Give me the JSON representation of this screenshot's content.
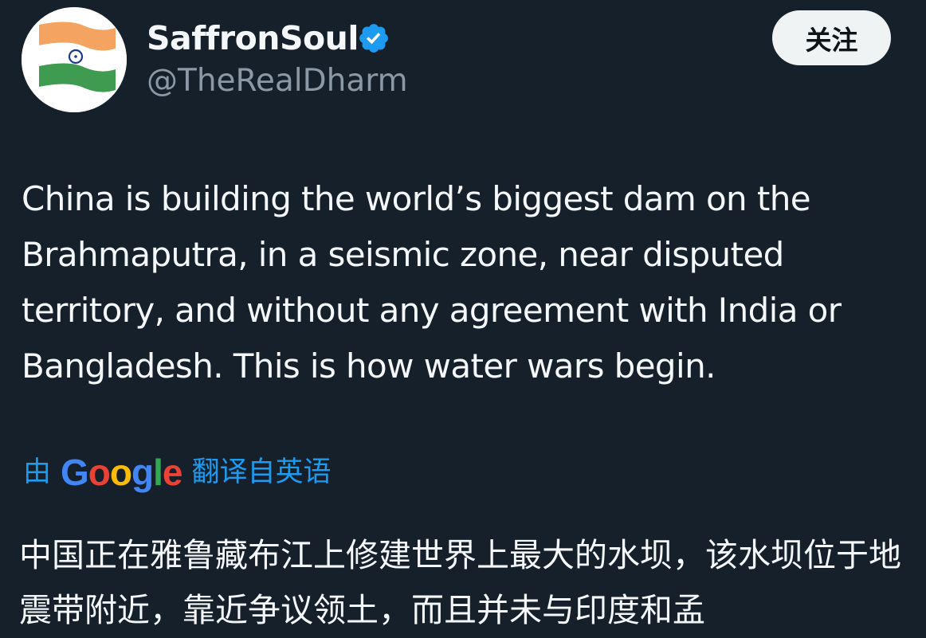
{
  "author": {
    "display_name": "SaffronSoul",
    "handle": "@TheRealDharm",
    "avatar_icon": "india-flag-icon",
    "verified": true,
    "verified_color": "#1d9bf0"
  },
  "follow_button": {
    "label": "关注"
  },
  "tweet": {
    "text": "China is building the world’s biggest dam on the Brahmaputra, in a seismic zone, near disputed territory, and without any agreement with India or Bangladesh. This is how water wars begin."
  },
  "translation": {
    "prefix": "由",
    "provider_letters": [
      "G",
      "o",
      "o",
      "g",
      "l",
      "e"
    ],
    "suffix": "翻译自英语",
    "text": "中国正在雅鲁藏布江上修建世界上最大的水坝，该水坝位于地震带附近，靠近争议领土，而且并未与印度和孟"
  },
  "colors": {
    "background": "#15202b",
    "text_primary": "#f5f8fa",
    "text_secondary": "#8b98a5",
    "accent": "#1d9bf0"
  }
}
